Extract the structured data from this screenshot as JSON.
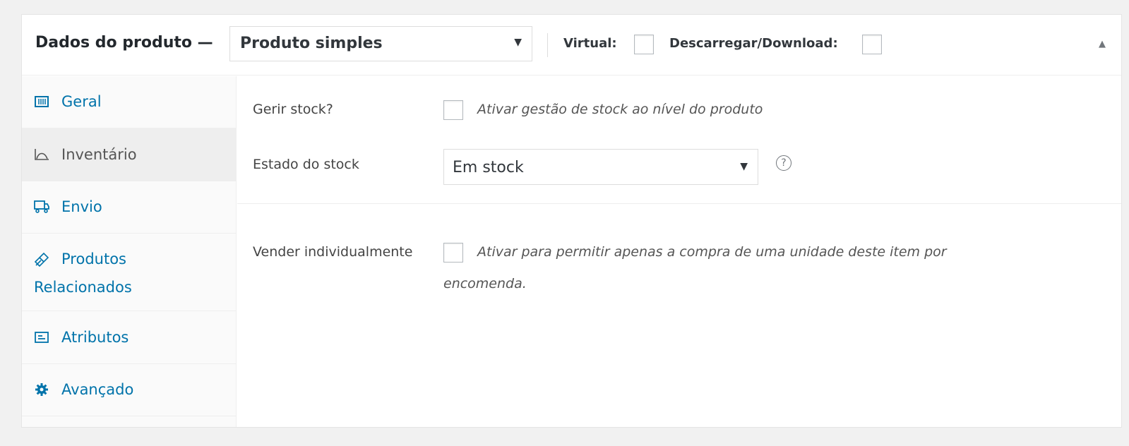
{
  "header": {
    "title": "Dados do produto —",
    "product_type": "Produto simples",
    "virtual_label": "Virtual:",
    "download_label": "Descarregar/Download:",
    "collapse_glyph": "▲",
    "select_arrow": "▼"
  },
  "tabs": [
    {
      "label": "Geral",
      "icon": "general-icon"
    },
    {
      "label": "Inventário",
      "icon": "inventory-icon"
    },
    {
      "label": "Envio",
      "icon": "shipping-icon"
    },
    {
      "label_line1": "Produtos",
      "label_line2": "Relacionados",
      "icon": "linked-products-icon"
    },
    {
      "label": "Atributos",
      "icon": "attributes-icon"
    },
    {
      "label": "Avançado",
      "icon": "gear-icon"
    }
  ],
  "inventory": {
    "manage_stock_label": "Gerir stock?",
    "manage_stock_desc": "Ativar gestão de stock ao nível do produto",
    "stock_status_label": "Estado do stock",
    "stock_status_value": "Em stock",
    "help_glyph": "?",
    "sold_individually_label": "Vender individualmente",
    "sold_individually_desc_line1": "Ativar para permitir apenas a compra de uma unidade deste item por",
    "sold_individually_desc_line2": "encomenda."
  },
  "colors": {
    "link": "#0073aa",
    "active_tab_bg": "#eeeeee",
    "tabs_bg": "#fafafa",
    "border": "#eeeeee"
  }
}
